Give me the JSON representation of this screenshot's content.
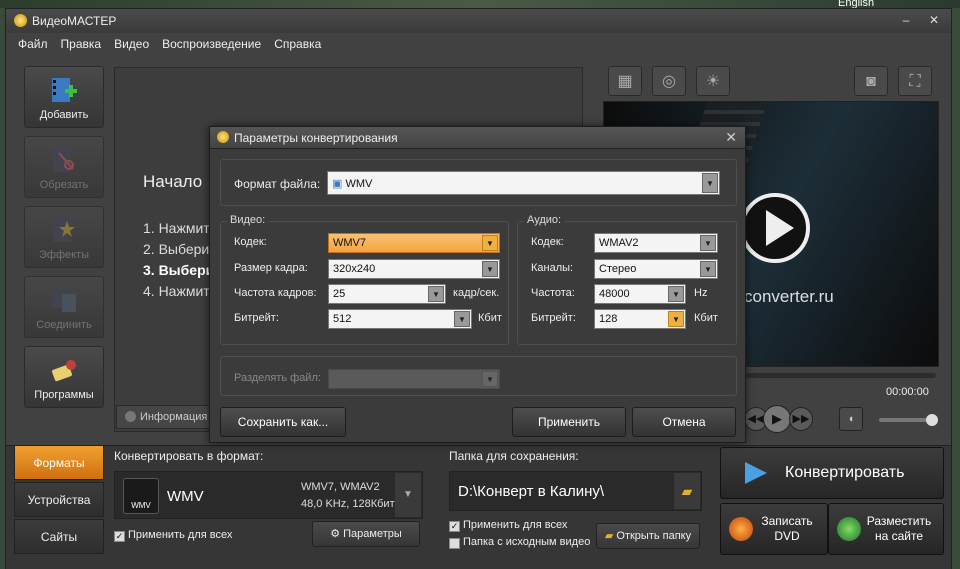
{
  "desktop": {
    "language_label": "English"
  },
  "app": {
    "title": "ВидеоМАСТЕР"
  },
  "menu": [
    "Файл",
    "Правка",
    "Видео",
    "Воспроизведение",
    "Справка"
  ],
  "sidebar": {
    "items": [
      {
        "label": "Добавить",
        "icon": "film-add-icon",
        "enabled": true
      },
      {
        "label": "Обрезать",
        "icon": "scissors-icon",
        "enabled": false
      },
      {
        "label": "Эффекты",
        "icon": "effects-icon",
        "enabled": false
      },
      {
        "label": "Соединить",
        "icon": "join-icon",
        "enabled": false
      },
      {
        "label": "Программы",
        "icon": "programs-icon",
        "enabled": true
      }
    ]
  },
  "main": {
    "heading": "Начало",
    "steps": [
      "1. Нажмит",
      "2. Выбери",
      "3. Выбери",
      "4. Нажмит"
    ],
    "info_tab": "Информация"
  },
  "player": {
    "brand": "converter.ru",
    "time": "00:00:00"
  },
  "bottom": {
    "tabs": [
      "Форматы",
      "Устройства",
      "Сайты"
    ],
    "convert_label": "Конвертировать в формат:",
    "format_name": "WMV",
    "format_badge": "WMV",
    "format_desc1": "WMV7, WMAV2",
    "format_desc2": "48,0 KHz, 128Кбит",
    "apply_all": "Применить для всех",
    "params_button": "Параметры",
    "save_folder_label": "Папка для сохранения:",
    "save_path": "D:\\Конверт в Калину\\",
    "folder_apply_all": "Применить для всех",
    "source_folder": "Папка с исходным видео",
    "open_folder": "Открыть папку",
    "convert_button": "Конвертировать",
    "burn_dvd": [
      "Записать",
      "DVD"
    ],
    "publish": [
      "Разместить",
      "на сайте"
    ]
  },
  "dialog": {
    "title": "Параметры конвертирования",
    "file_format_label": "Формат файла:",
    "file_format_value": "WMV",
    "video": {
      "group": "Видео:",
      "codec_label": "Кодек:",
      "codec": "WMV7",
      "frame_label": "Размер кадра:",
      "frame": "320x240",
      "fps_label": "Частота кадров:",
      "fps": "25",
      "fps_unit": "кадр/сек.",
      "bitrate_label": "Битрейт:",
      "bitrate": "512",
      "bitrate_unit": "Кбит"
    },
    "audio": {
      "group": "Аудио:",
      "codec_label": "Кодек:",
      "codec": "WMAV2",
      "channels_label": "Каналы:",
      "channels": "Стерео",
      "freq_label": "Частота:",
      "freq": "48000",
      "freq_unit": "Hz",
      "bitrate_label": "Битрейт:",
      "bitrate": "128",
      "bitrate_unit": "Кбит"
    },
    "split_label": "Разделять файл:",
    "save_as": "Сохранить как...",
    "apply": "Применить",
    "cancel": "Отмена"
  }
}
